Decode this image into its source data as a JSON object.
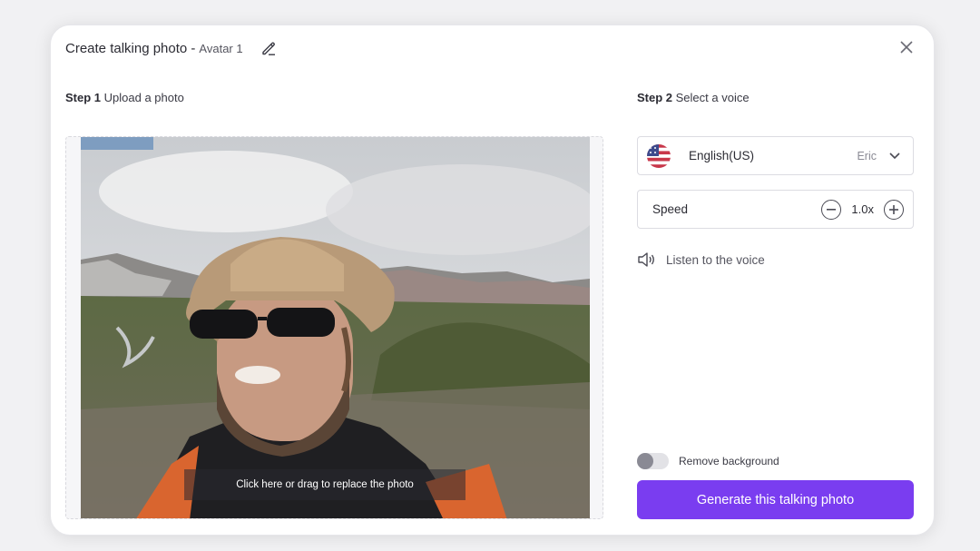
{
  "dialog": {
    "title": "Create talking photo -",
    "avatar_name": "Avatar 1"
  },
  "step1": {
    "step": "Step 1",
    "label": "Upload a photo",
    "replace_hint": "Click here or drag to replace the photo"
  },
  "step2": {
    "step": "Step 2",
    "label": "Select a voice",
    "language": "English(US)",
    "voice": "Eric",
    "speed_label": "Speed",
    "speed_value": "1.0x",
    "listen_label": "Listen to the voice"
  },
  "options": {
    "remove_background_label": "Remove background",
    "remove_background_on": false
  },
  "actions": {
    "generate_label": "Generate this talking photo"
  },
  "icons": [
    "pencil-icon",
    "close-icon",
    "us-flag-icon",
    "chevron-down-icon",
    "minus-circle-icon",
    "plus-circle-icon",
    "speaker-icon"
  ],
  "colors": {
    "accent": "#7a3df0",
    "toggle_off": "#8a8a94"
  }
}
